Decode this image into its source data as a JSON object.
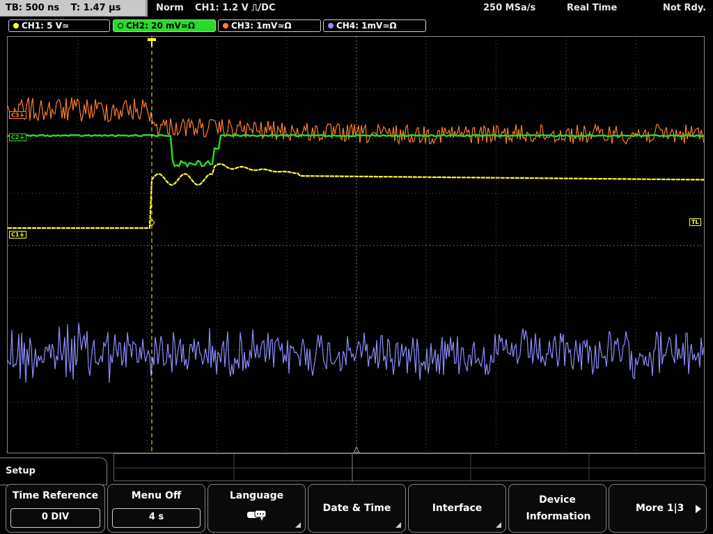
{
  "status": {
    "timebase": "TB: 500 ns",
    "trigger_time": "T: 1.47 µs",
    "mode": "Norm",
    "trigger_info": "CH1: 1.2 V ⎍/DC",
    "sample_rate": "250 MSa/s",
    "acq_mode": "Real Time",
    "state": "Not Rdy."
  },
  "channels": [
    {
      "label": "CH1: 5 V≃",
      "color": "#ffff33",
      "active": false
    },
    {
      "label": "CH2: 20 mV≃Ω",
      "color": "#33dd33",
      "active": true
    },
    {
      "label": "CH3: 1mV≃Ω",
      "color": "#ff8030",
      "active": false
    },
    {
      "label": "CH4: 1mV≃Ω",
      "color": "#8f8fff",
      "active": false
    }
  ],
  "markers": {
    "c1": "C1",
    "c2": "C2",
    "c3": "C3",
    "tl": "TL"
  },
  "menu": {
    "title": "Setup",
    "softkeys": [
      {
        "label": "Time Reference",
        "value": "0 DIV"
      },
      {
        "label": "Menu Off",
        "value": "4 s"
      },
      {
        "label": "Language",
        "value": ""
      },
      {
        "label": "Date & Time",
        "value": ""
      },
      {
        "label": "Interface",
        "value": ""
      },
      {
        "label": "Device Information",
        "value": ""
      },
      {
        "label": "More 1|3",
        "value": ""
      }
    ]
  },
  "colors": {
    "ch1": "#ffff33",
    "ch2": "#22dd22",
    "ch3": "#ff8030",
    "ch4": "#8f8fff",
    "grid": "#555555"
  }
}
